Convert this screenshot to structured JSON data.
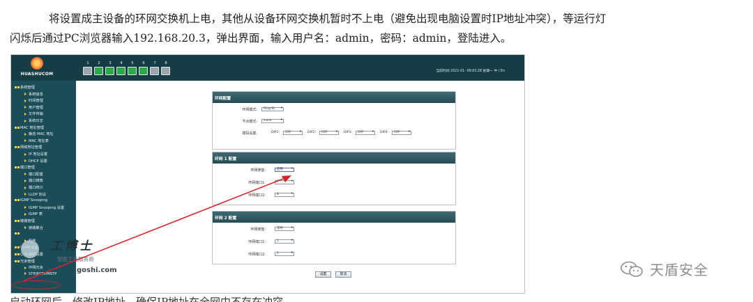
{
  "doc": {
    "line1": "将设置成主设备的环网交换机上电，其他从设备环网交换机暂时不上电（避免出现电脑设置时IP地址冲突），等运行灯",
    "line2": "闪烁后通过PC浏览器输入192.168.20.3，弹出界面，输入用户名：admin，密码：admin，登陆进入。",
    "line3": "启动环网后，修改IP地址，确保IP地址在全网中不存在冲突。"
  },
  "switch_ui": {
    "brand": "HUASHUCOM",
    "status_text": "当前时间 2021-01-   09:03:28  星期一    中 / En",
    "ports": [
      {
        "num": "1",
        "state": "down"
      },
      {
        "num": "2",
        "state": "up"
      },
      {
        "num": "3",
        "state": "up"
      },
      {
        "num": "4",
        "state": "up"
      },
      {
        "num": "5",
        "state": "up"
      },
      {
        "num": "6",
        "state": "up"
      },
      {
        "num": "7",
        "state": "down"
      },
      {
        "num": "8",
        "state": "down"
      }
    ],
    "sidebar": [
      {
        "type": "group",
        "label": "系统管理"
      },
      {
        "type": "child",
        "label": "系统信息"
      },
      {
        "type": "child",
        "label": "时间管理"
      },
      {
        "type": "child",
        "label": "用户管理"
      },
      {
        "type": "child",
        "label": "文件传输"
      },
      {
        "type": "child",
        "label": "系统日志"
      },
      {
        "type": "group",
        "label": "MAC 地址管理"
      },
      {
        "type": "child",
        "label": "静态 MAC 地址"
      },
      {
        "type": "child",
        "label": "MAC 地址表"
      },
      {
        "type": "group",
        "label": "网络地址管理"
      },
      {
        "type": "child",
        "label": "IP 地址设置"
      },
      {
        "type": "child",
        "label": "DHCP 设置"
      },
      {
        "type": "group",
        "label": "端口管理"
      },
      {
        "type": "child",
        "label": "端口配置"
      },
      {
        "type": "child",
        "label": "端口镜像"
      },
      {
        "type": "child",
        "label": "端口统计"
      },
      {
        "type": "child",
        "label": "LLDP 协议"
      },
      {
        "type": "group",
        "label": "IGMP Snooping"
      },
      {
        "type": "child",
        "label": "IGMP Snooping 设置"
      },
      {
        "type": "child",
        "label": "IGMP 表"
      },
      {
        "type": "group",
        "label": "链路管理"
      },
      {
        "type": "child",
        "label": "链路聚合"
      },
      {
        "type": "group",
        "label": "  "
      },
      {
        "type": "child",
        "label": "配置"
      },
      {
        "type": "group",
        "label": "VLAN 设置"
      },
      {
        "type": "group",
        "label": "QoS 高级设置"
      },
      {
        "type": "group",
        "label": "冗余管理"
      },
      {
        "type": "child",
        "label": "环网冗余"
      },
      {
        "type": "child",
        "label": "STP/RSTP/MSTP"
      }
    ],
    "ring_config": {
      "title": "环网配置",
      "mode_label": "环网模式:",
      "mode_value": "Ring-SL",
      "node_label": "节点模式:",
      "node_value": "slave",
      "dip_label": "拨码设置:",
      "dips": [
        {
          "label": "DIP1:",
          "value": "OFF"
        },
        {
          "label": "DIP2:",
          "value": "OFF"
        },
        {
          "label": "DIP3:",
          "value": "OFF"
        },
        {
          "label": "DIP4:",
          "value": "OFF"
        }
      ]
    },
    "ring1": {
      "title": "环网 1 配置",
      "enable_label": "环网使能:",
      "enable_value": "启用",
      "port1_label": "环网端口1:",
      "port1_value": "7",
      "port2_label": "环网端口2:",
      "port2_value": "8"
    },
    "ring2": {
      "title": "环网 2 配置",
      "enable_label": "环网使能:",
      "enable_value": "禁用",
      "port1_label": "环网端口1:",
      "port1_value": "1",
      "port2_label": "环网端口2:",
      "port2_value": "2"
    },
    "buttons": {
      "apply": "设置",
      "cancel": "取消"
    }
  },
  "watermarks": {
    "site_title": "工博士",
    "site_sub": "智能工业服务商",
    "site_url": "goshi.com",
    "wechat": "天盾安全"
  },
  "colors": {
    "topbar": "#163d45",
    "sidebar": "#1b4d58",
    "port_up": "#2fa84a",
    "annotation": "#d8232a"
  }
}
